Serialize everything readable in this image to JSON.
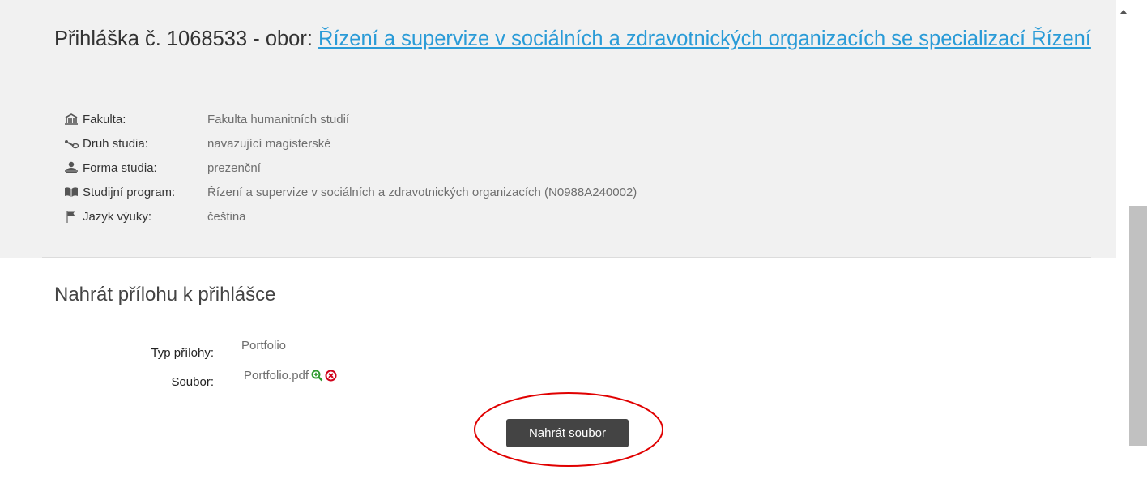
{
  "application": {
    "title_prefix": "Přihláška č. 1068533 - obor: ",
    "field_link": "Řízení a supervize v sociálních a zdravotnických organizacích se specializací Řízení"
  },
  "info": [
    {
      "icon": "building-icon",
      "label": "Fakulta:",
      "value": "Fakulta humanitních studií"
    },
    {
      "icon": "study-type-icon",
      "label": "Druh studia:",
      "value": "navazující magisterské"
    },
    {
      "icon": "person-icon",
      "label": "Forma studia:",
      "value": "prezenční"
    },
    {
      "icon": "book-icon",
      "label": "Studijní program:",
      "value": "Řízení a supervize v sociálních a zdravotnických organizacích (N0988A240002)"
    },
    {
      "icon": "flag-icon",
      "label": "Jazyk výuky:",
      "value": "čeština"
    }
  ],
  "upload": {
    "section_title": "Nahrát přílohu k přihlášce",
    "type_label": "Typ přílohy:",
    "type_value": "Portfolio",
    "file_label": "Soubor:",
    "file_name": "Portfolio.pdf",
    "button_label": "Nahrát soubor"
  },
  "colors": {
    "link": "#2a9bd7",
    "button_bg": "#444444",
    "annotation": "#e00000",
    "zoom_icon": "#2e9b2e",
    "remove_icon": "#d0021b"
  }
}
